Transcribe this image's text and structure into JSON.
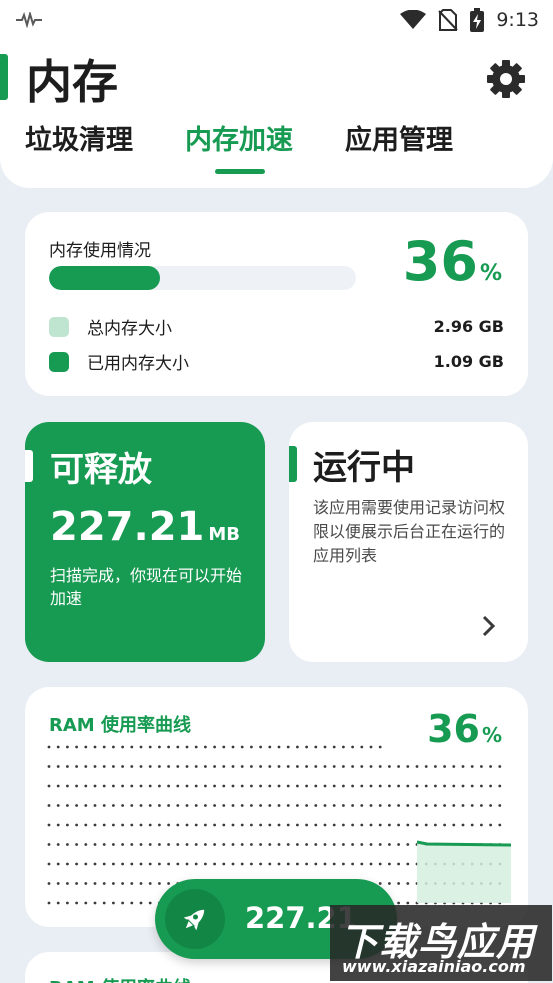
{
  "status_bar": {
    "time": "9:13"
  },
  "header": {
    "title": "内存",
    "tabs": [
      {
        "label": "垃圾清理",
        "active": false
      },
      {
        "label": "内存加速",
        "active": true
      },
      {
        "label": "应用管理",
        "active": false
      }
    ]
  },
  "memory_usage": {
    "label": "内存使用情况",
    "percent": 36,
    "percent_value": "36",
    "percent_sign": "%",
    "legend": [
      {
        "label": "总内存大小",
        "value": "2.96 GB",
        "color": "#bfe4cf"
      },
      {
        "label": "已用内存大小",
        "value": "1.09 GB",
        "color": "#179a52"
      }
    ]
  },
  "releasable": {
    "title": "可释放",
    "size": "227.21",
    "unit": "MB",
    "description": "扫描完成，你现在可以开始加速"
  },
  "running": {
    "title": "运行中",
    "description": "该应用需要使用记录访问权限以便展示后台正在运行的应用列表"
  },
  "ram_curve": {
    "title": "RAM 使用率曲线",
    "percent_value": "36",
    "percent_sign": "%"
  },
  "ram_curve_2": {
    "title": "RAM 使用率曲线"
  },
  "fab": {
    "label": "227.21"
  },
  "watermark": {
    "main": "下载鸟应用",
    "sub": "www.xiazainiao.com"
  },
  "colors": {
    "accent": "#179a52",
    "background": "#e9eef4",
    "card": "#ffffff"
  }
}
